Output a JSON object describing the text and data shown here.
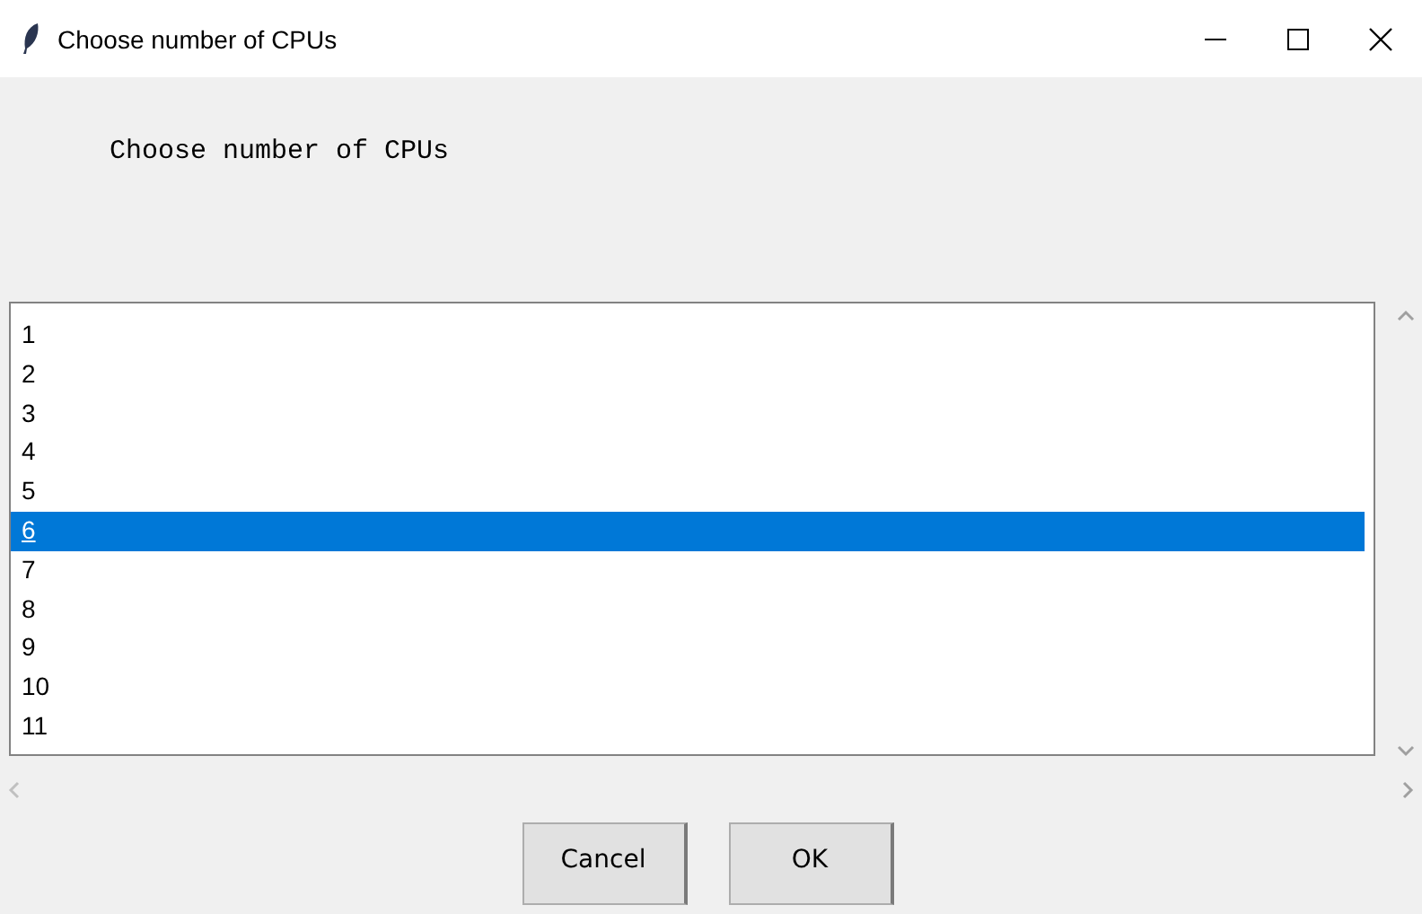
{
  "window": {
    "title": "Choose number of CPUs"
  },
  "prompt": "Choose number of CPUs",
  "list": {
    "items": [
      {
        "label": "1",
        "selected": false
      },
      {
        "label": "2",
        "selected": false
      },
      {
        "label": "3",
        "selected": false
      },
      {
        "label": "4",
        "selected": false
      },
      {
        "label": "5",
        "selected": false
      },
      {
        "label": "6",
        "selected": true
      },
      {
        "label": "7",
        "selected": false
      },
      {
        "label": "8",
        "selected": false
      },
      {
        "label": "9",
        "selected": false
      },
      {
        "label": "10",
        "selected": false
      },
      {
        "label": "11",
        "selected": false
      }
    ]
  },
  "buttons": [
    {
      "label": "Cancel"
    },
    {
      "label": "OK"
    }
  ]
}
